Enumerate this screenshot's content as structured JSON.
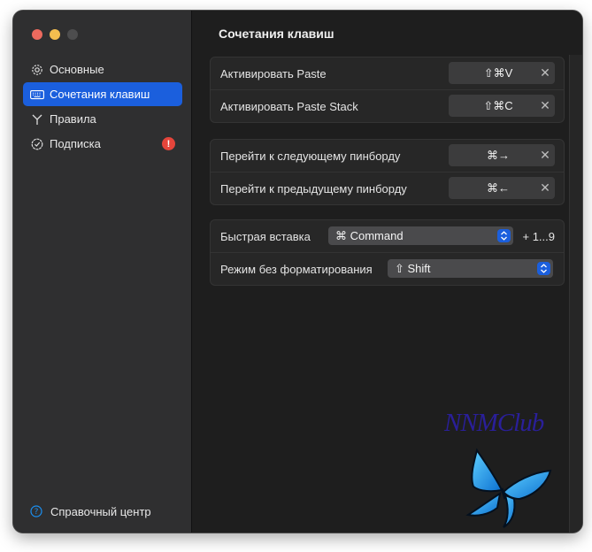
{
  "window": {
    "sidebar": {
      "items": [
        {
          "label": "Основные",
          "icon": "gear-icon"
        },
        {
          "label": "Сочетания клавиш",
          "icon": "keyboard-icon"
        },
        {
          "label": "Правила",
          "icon": "branch-icon"
        },
        {
          "label": "Подписка",
          "icon": "checkmark-seal-icon",
          "badge": "!"
        }
      ],
      "help_label": "Справочный центр"
    },
    "main": {
      "title": "Сочетания клавиш",
      "groups": [
        {
          "rows": [
            {
              "label": "Активировать Paste",
              "shortcut": "⇧⌘V"
            },
            {
              "label": "Активировать Paste Stack",
              "shortcut": "⇧⌘C"
            }
          ]
        },
        {
          "rows": [
            {
              "label": "Перейти к следующему пинборду",
              "shortcut": "⌘→"
            },
            {
              "label": "Перейти к предыдущему пинборду",
              "shortcut": "⌘←"
            }
          ]
        },
        {
          "rows": [
            {
              "label": "Быстрая вставка",
              "select_value": "⌘ Command",
              "suffix": "+ 1...9"
            },
            {
              "label": "Режим без форматирования",
              "select_value": "⇧ Shift"
            }
          ]
        }
      ],
      "clear_symbol": "✕"
    }
  },
  "watermark": "NNMClub",
  "colors": {
    "accent": "#1b5fdd",
    "badge": "#e5453b",
    "watermark": "#2a1f9a",
    "butterfly": "#1e9be8"
  }
}
